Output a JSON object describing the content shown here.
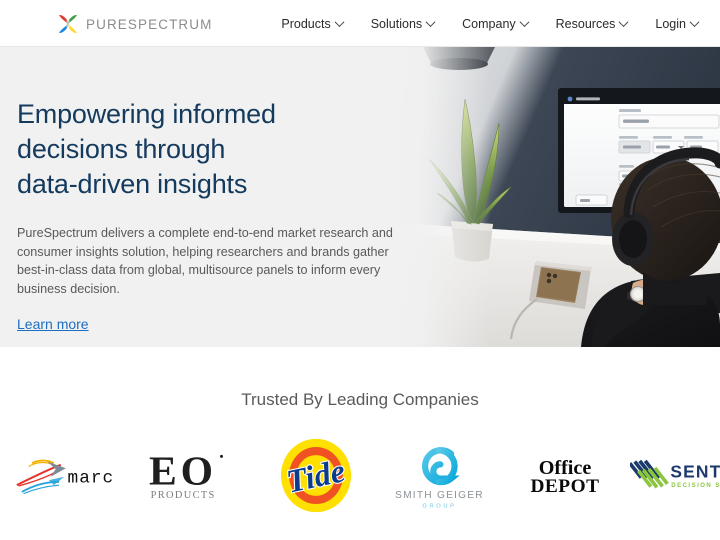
{
  "header": {
    "logo_icon": "purespectrum-butterfly-icon",
    "brand_name": "PURESPECTRUM",
    "nav_items": [
      {
        "label": "Products",
        "icon": "chevron-down-icon"
      },
      {
        "label": "Solutions",
        "icon": "chevron-down-icon"
      },
      {
        "label": "Company",
        "icon": "chevron-down-icon"
      },
      {
        "label": "Resources",
        "icon": "chevron-down-icon"
      },
      {
        "label": "Login",
        "icon": "chevron-down-icon"
      }
    ]
  },
  "hero": {
    "title_line1": "Empowering informed",
    "title_line2": "decisions through",
    "title_line3": "data-driven insights",
    "paragraph": "PureSpectrum delivers a complete end-to-end market research and consumer insights solution, helping researchers and brands gather best-in-class data from global, multisource panels to inform every business decision.",
    "link_label": "Learn more",
    "image_alt": "man-with-headphones-at-desk-photo",
    "background_color": "#f1f1f1",
    "title_color": "#143a5e",
    "link_color": "#1b6ec2"
  },
  "trusted": {
    "heading": "Trusted By Leading Companies",
    "logos": [
      {
        "name": "marc",
        "label": "marc"
      },
      {
        "name": "eo-products",
        "label": "EO",
        "sub": "PRODUCTS"
      },
      {
        "name": "tide",
        "label": "Tide"
      },
      {
        "name": "smith-geiger",
        "label": "SMITH GEIGER",
        "sub": "GROUP"
      },
      {
        "name": "office-depot",
        "label": "Office",
        "sub": "DEPOT"
      },
      {
        "name": "sentient",
        "label": "SENTIENT",
        "sub": "DECISION SCIENCE"
      }
    ]
  }
}
